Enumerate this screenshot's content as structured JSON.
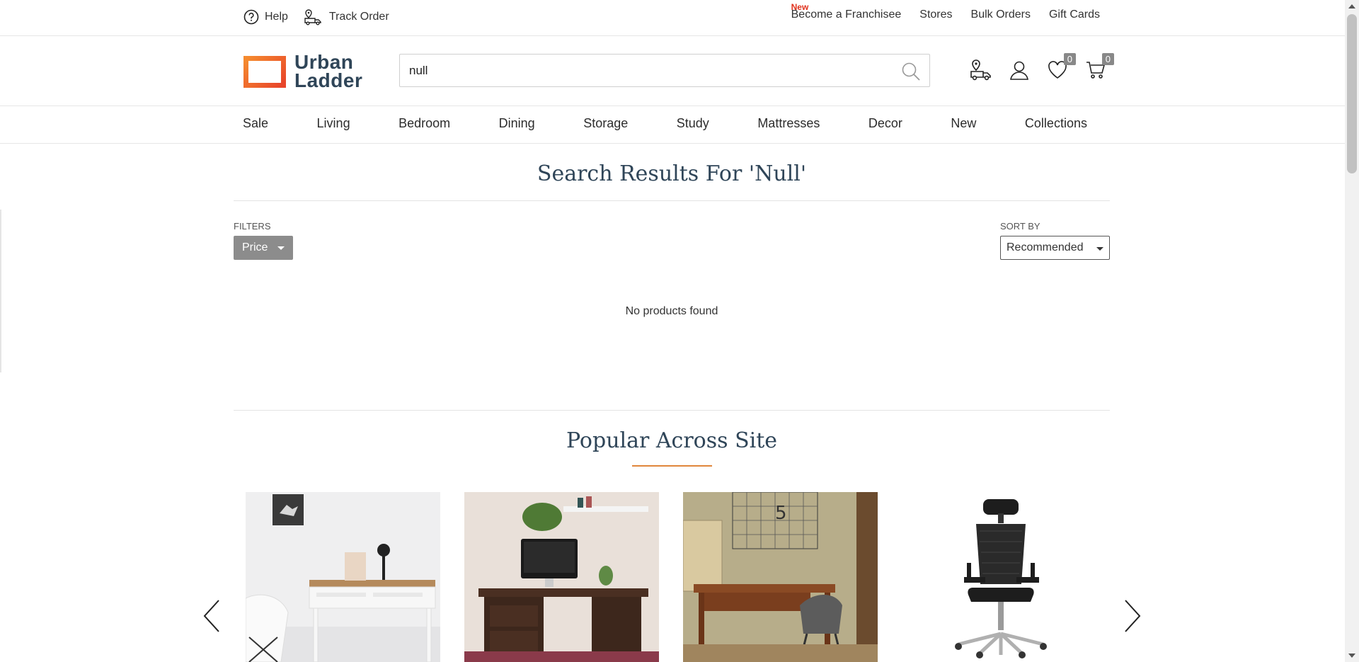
{
  "util_bar": {
    "help": "Help",
    "track_order": "Track Order",
    "new_tag": "New",
    "links": [
      "Become a Franchisee",
      "Stores",
      "Bulk Orders",
      "Gift Cards"
    ]
  },
  "header": {
    "logo_line1": "Urban",
    "logo_line2": "Ladder",
    "search_value": "null",
    "wishlist_count": "0",
    "cart_count": "0"
  },
  "nav": [
    "Sale",
    "Living",
    "Bedroom",
    "Dining",
    "Storage",
    "Study",
    "Mattresses",
    "Decor",
    "New",
    "Collections"
  ],
  "results": {
    "title": "Search Results For 'Null'",
    "filters_label": "FILTERS",
    "price_filter": "Price",
    "sort_label": "SORT BY",
    "sort_value": "Recommended",
    "empty_message": "No products found"
  },
  "popular": {
    "title": "Popular Across Site",
    "cards": [
      "white-study-desk",
      "dark-wood-desk",
      "sheesham-writing-desk",
      "ergonomic-office-chair"
    ]
  },
  "colors": {
    "brand_navy": "#2f4558",
    "brand_orange": "#e8452a",
    "accent_line": "#e0863b",
    "badge_grey": "#888888"
  }
}
